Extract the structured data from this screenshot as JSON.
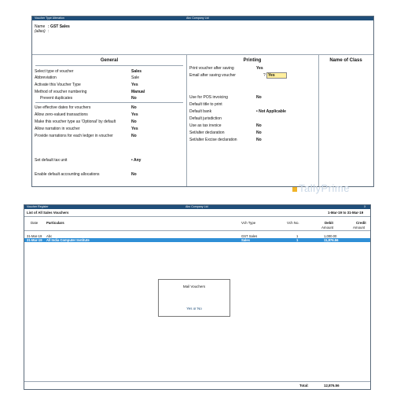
{
  "top_window": {
    "title": "Voucher Type Alteration",
    "company": "Abc Company Ltd",
    "name_label": "Name",
    "name_value": ": GST Sales",
    "alias_label": "(alias)",
    "alias_value": ":",
    "general": {
      "header": "General",
      "rows": [
        {
          "label": "Select type of voucher",
          "value": "Sales"
        },
        {
          "label": "Abbreviation",
          "value": "Sale"
        },
        {
          "label": "Activate this Voucher Type",
          "value": "Yes"
        },
        {
          "label": "Method of voucher numbering",
          "value": "Manual"
        },
        {
          "label": "Prevent duplicates",
          "value": "No"
        },
        {
          "label": "Use effective dates for vouchers",
          "value": "No"
        },
        {
          "label": "Allow zero-valued transactions",
          "value": "Yes"
        },
        {
          "label": "Make this voucher type as 'Optional' by default",
          "value": "No"
        },
        {
          "label": "Allow narration in voucher",
          "value": "Yes"
        },
        {
          "label": "Provide narrations for each ledger in voucher",
          "value": "No"
        }
      ],
      "tax_unit_label": "Set default tax unit",
      "tax_unit_value": "• Any",
      "accounting_label": "Enable default accounting allocations",
      "accounting_value": "No"
    },
    "printing": {
      "header": "Printing",
      "rows": [
        {
          "label": "Print voucher after saving",
          "value": "Yes"
        },
        {
          "label": "Email after saving voucher",
          "value": "Yes"
        },
        {
          "label": "Use for POS invoicing",
          "value": "No"
        },
        {
          "label": "Default title to print",
          "value": ""
        },
        {
          "label": "Default bank",
          "value": "• Not Applicable"
        },
        {
          "label": "Default jurisdiction",
          "value": ""
        },
        {
          "label": "Use as tax invoice",
          "value": "No"
        },
        {
          "label": "Set/alter declaration",
          "value": "No"
        },
        {
          "label": "Set/alter Excise declaration",
          "value": "No"
        }
      ]
    },
    "class_header": "Name of Class"
  },
  "watermark": "TallyPrime",
  "register": {
    "title": "Voucher Register",
    "company": "Abc Company Ltd",
    "close": "X",
    "subtitle": "List of All Sales Vouchers",
    "period": "1-Mar-19 to 31-Mar-19",
    "columns": {
      "date": "Date",
      "particulars": "Particulars",
      "vch_type": "Vch Type",
      "vch_no": "Vch No.",
      "debit": "Debit",
      "debit_sub": "Amount",
      "credit": "Credit",
      "credit_sub": "Amount"
    },
    "rows": [
      {
        "date": "31-Mar-19",
        "particulars": "Abc",
        "vch_type": "GST Sales",
        "vch_no": "1",
        "debit": "1,000.00"
      },
      {
        "date": "31-Mar-19",
        "particulars": "All India Computer Institute",
        "vch_type": "Sales",
        "vch_no": "1",
        "debit": "11,876.56"
      }
    ],
    "dialog": {
      "title": "Mail Vouchers",
      "prompt": "Yes or No"
    },
    "total_label": "Total:",
    "total_value": "12,876.56"
  }
}
